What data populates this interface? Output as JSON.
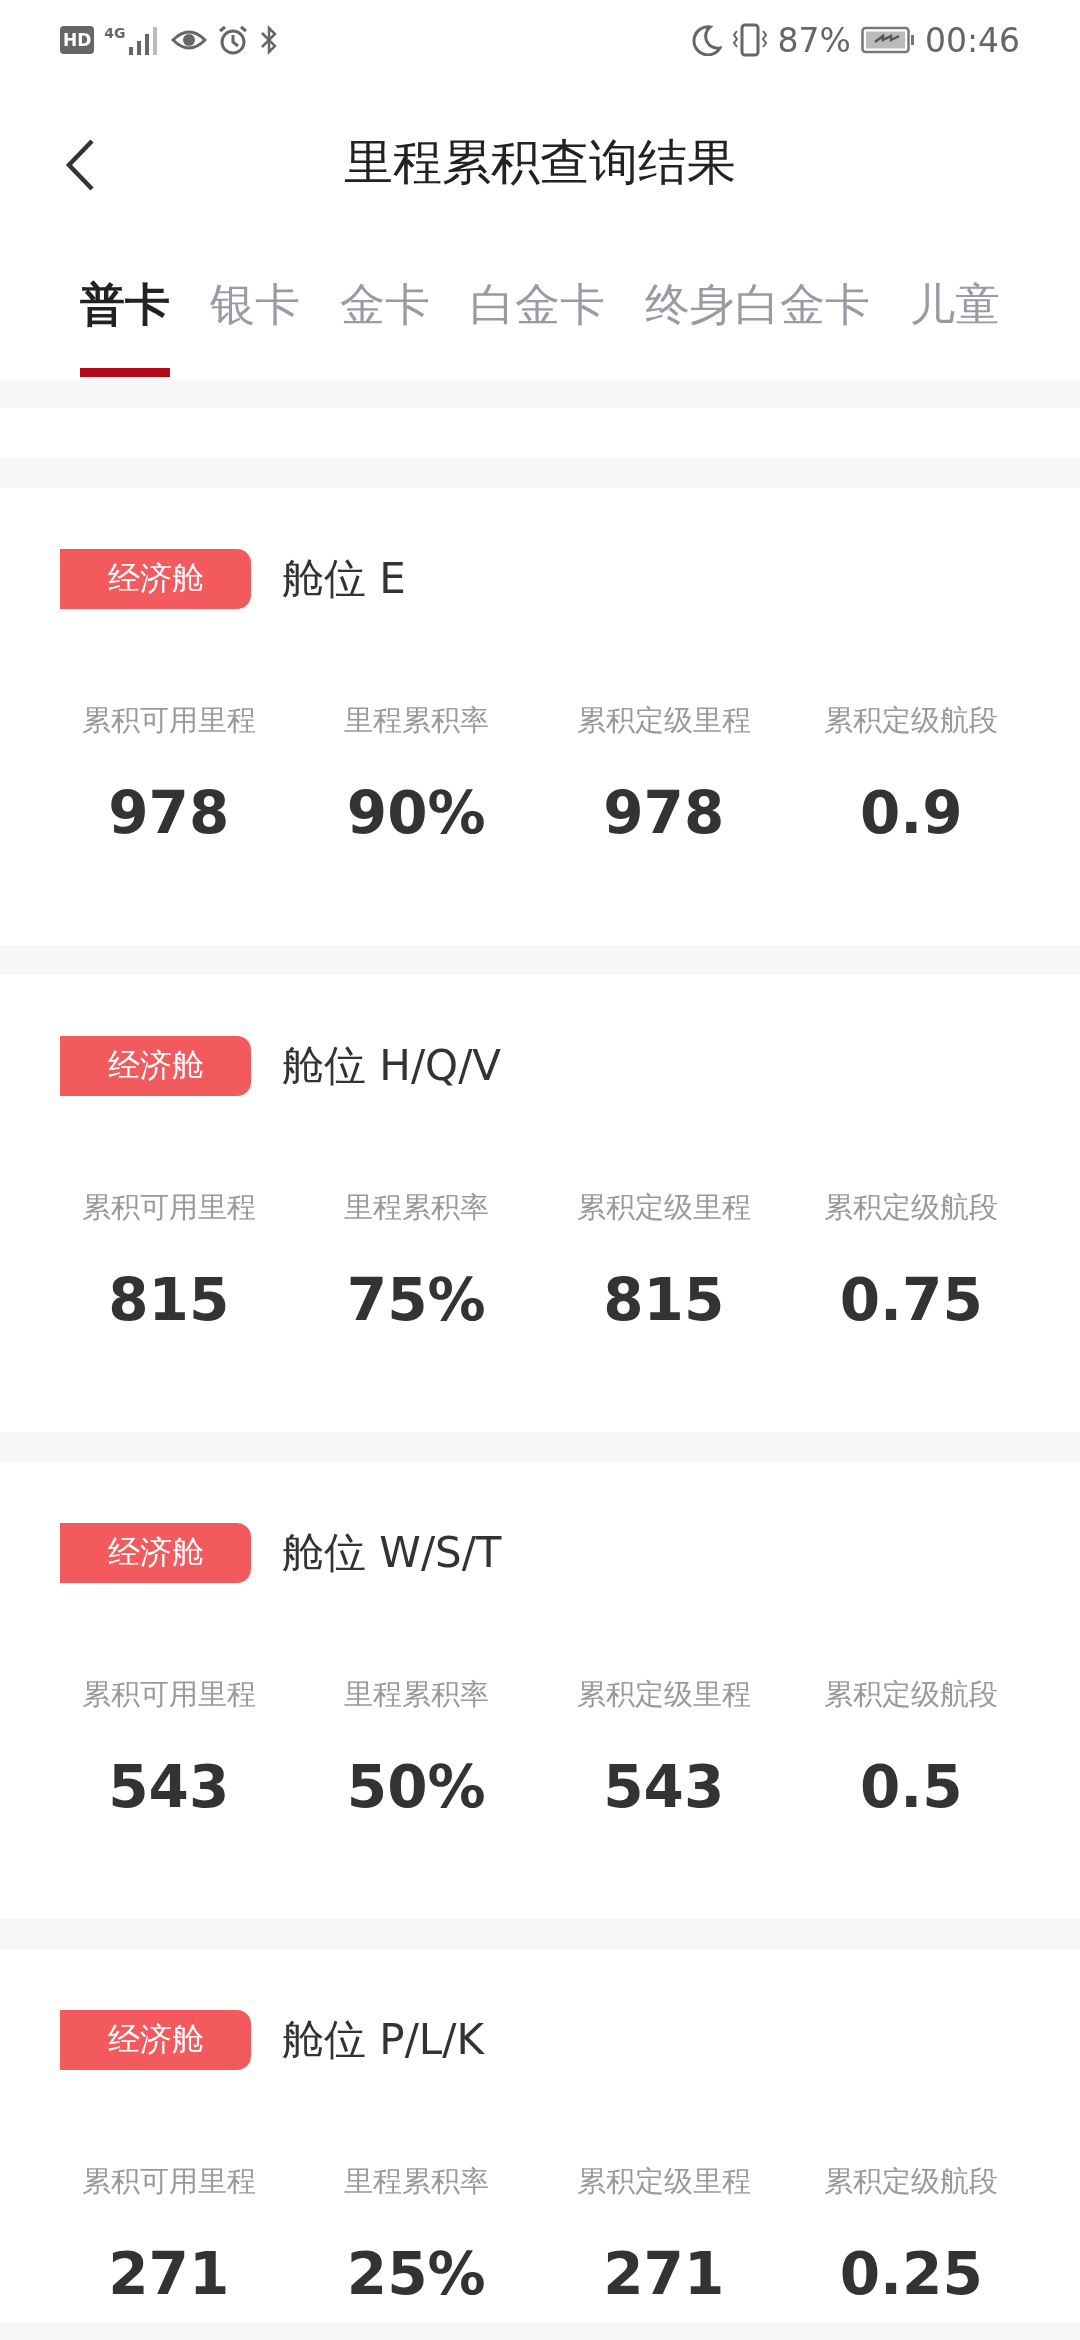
{
  "status_bar": {
    "hd": "HD",
    "network": "4G",
    "battery_percent": "87%",
    "time": "00:46"
  },
  "header": {
    "title": "里程累积查询结果"
  },
  "tabs": [
    {
      "label": "普卡",
      "selected": true
    },
    {
      "label": "银卡",
      "selected": false
    },
    {
      "label": "金卡",
      "selected": false
    },
    {
      "label": "白金卡",
      "selected": false
    },
    {
      "label": "终身白金卡",
      "selected": false
    },
    {
      "label": "儿童",
      "selected": false
    }
  ],
  "cabins": [
    {
      "badge": "经济舱",
      "class_name": "舱位 E",
      "stats": [
        {
          "label": "累积可用里程",
          "value": "978"
        },
        {
          "label": "里程累积率",
          "value": "90%"
        },
        {
          "label": "累积定级里程",
          "value": "978"
        },
        {
          "label": "累积定级航段",
          "value": "0.9"
        }
      ]
    },
    {
      "badge": "经济舱",
      "class_name": "舱位 H/Q/V",
      "stats": [
        {
          "label": "累积可用里程",
          "value": "815"
        },
        {
          "label": "里程累积率",
          "value": "75%"
        },
        {
          "label": "累积定级里程",
          "value": "815"
        },
        {
          "label": "累积定级航段",
          "value": "0.75"
        }
      ]
    },
    {
      "badge": "经济舱",
      "class_name": "舱位 W/S/T",
      "stats": [
        {
          "label": "累积可用里程",
          "value": "543"
        },
        {
          "label": "里程累积率",
          "value": "50%"
        },
        {
          "label": "累积定级里程",
          "value": "543"
        },
        {
          "label": "累积定级航段",
          "value": "0.5"
        }
      ]
    },
    {
      "badge": "经济舱",
      "class_name": "舱位 P/L/K",
      "stats": [
        {
          "label": "累积可用里程",
          "value": "271"
        },
        {
          "label": "里程累积率",
          "value": "25%"
        },
        {
          "label": "累积定级里程",
          "value": "271"
        },
        {
          "label": "累积定级航段",
          "value": "0.25"
        }
      ]
    }
  ]
}
